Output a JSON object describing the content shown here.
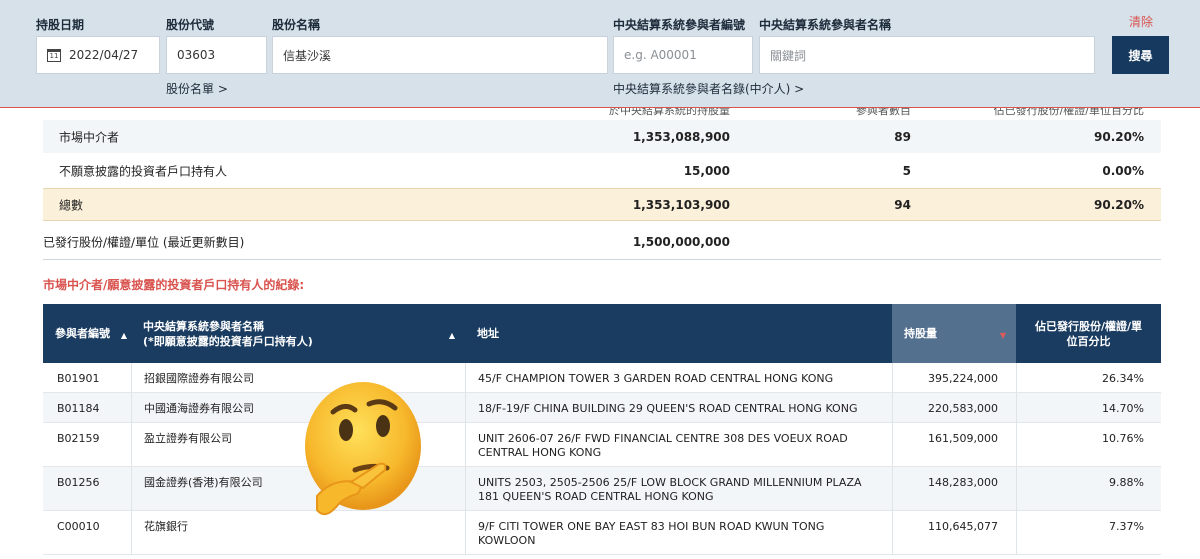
{
  "search": {
    "date_label": "持股日期",
    "date_value": "2022/04/27",
    "code_label": "股份代號",
    "code_value": "03603",
    "name_label": "股份名稱",
    "name_value": "信基沙溪",
    "ccass_id_label": "中央結算系統參與者編號",
    "ccass_id_placeholder": "e.g. A00001",
    "ccass_name_label": "中央結算系統參與者名稱",
    "ccass_name_placeholder": "關鍵詞",
    "stock_list_link": "股份名單 >",
    "participant_list_link": "中央結算系統參與者名錄(中介人) >",
    "clear_label": "清除",
    "search_button": "搜尋",
    "calendar_icon_text": "11"
  },
  "summary": {
    "headers": {
      "holding": "於中央結算系統的持股量",
      "participants": "參與者數目",
      "percent": "佔已發行股份/權證/單位百分比"
    },
    "rows": [
      {
        "label": "市場中介者",
        "holding": "1,353,088,900",
        "participants": "89",
        "percent": "90.20%"
      },
      {
        "label": "不願意披露的投資者戶口持有人",
        "holding": "15,000",
        "participants": "5",
        "percent": "0.00%"
      },
      {
        "label": "總數",
        "holding": "1,353,103,900",
        "participants": "94",
        "percent": "90.20%"
      }
    ],
    "issued_label": "已發行股份/權證/單位 (最近更新數目)",
    "issued_value": "1,500,000,000"
  },
  "records_title": "市場中介者/願意披露的投資者戶口持有人的紀錄:",
  "table": {
    "headers": {
      "id": "參與者編號",
      "name_line1": "中央結算系統參與者名稱",
      "name_line2": "(*即願意披露的投資者戶口持有人)",
      "address": "地址",
      "holding": "持股量",
      "percent_line1": "佔已發行股份/權證/單",
      "percent_line2": "位百分比"
    },
    "rows": [
      {
        "id": "B01901",
        "name": "招銀國際證券有限公司",
        "address": "45/F CHAMPION TOWER 3 GARDEN ROAD CENTRAL HONG KONG",
        "holding": "395,224,000",
        "percent": "26.34%"
      },
      {
        "id": "B01184",
        "name": "中國通海證券有限公司",
        "address": "18/F-19/F CHINA BUILDING 29 QUEEN'S ROAD CENTRAL HONG KONG",
        "holding": "220,583,000",
        "percent": "14.70%"
      },
      {
        "id": "B02159",
        "name": "盈立證券有限公司",
        "address": "UNIT 2606-07 26/F FWD FINANCIAL CENTRE 308 DES VOEUX ROAD CENTRAL HONG KONG",
        "holding": "161,509,000",
        "percent": "10.76%"
      },
      {
        "id": "B01256",
        "name": "國金證券(香港)有限公司",
        "address": "UNITS 2503, 2505-2506 25/F LOW BLOCK GRAND MILLENNIUM PLAZA 181 QUEEN'S ROAD CENTRAL HONG KONG",
        "holding": "148,283,000",
        "percent": "9.88%"
      },
      {
        "id": "C00010",
        "name": "花旗銀行",
        "address": "9/F CITI TOWER ONE BAY EAST 83 HOI BUN ROAD KWUN TONG KOWLOON",
        "holding": "110,645,077",
        "percent": "7.37%"
      }
    ]
  },
  "colors": {
    "header_navy": "#1a3c61",
    "sorted_column": "#54708f",
    "accent_red": "#d9534f",
    "total_row": "#fbf0d9",
    "panel_bg": "#d6e1ea"
  },
  "icons": [
    "calendar-icon",
    "sort-arrow-icon",
    "thinking-face-emoji"
  ]
}
